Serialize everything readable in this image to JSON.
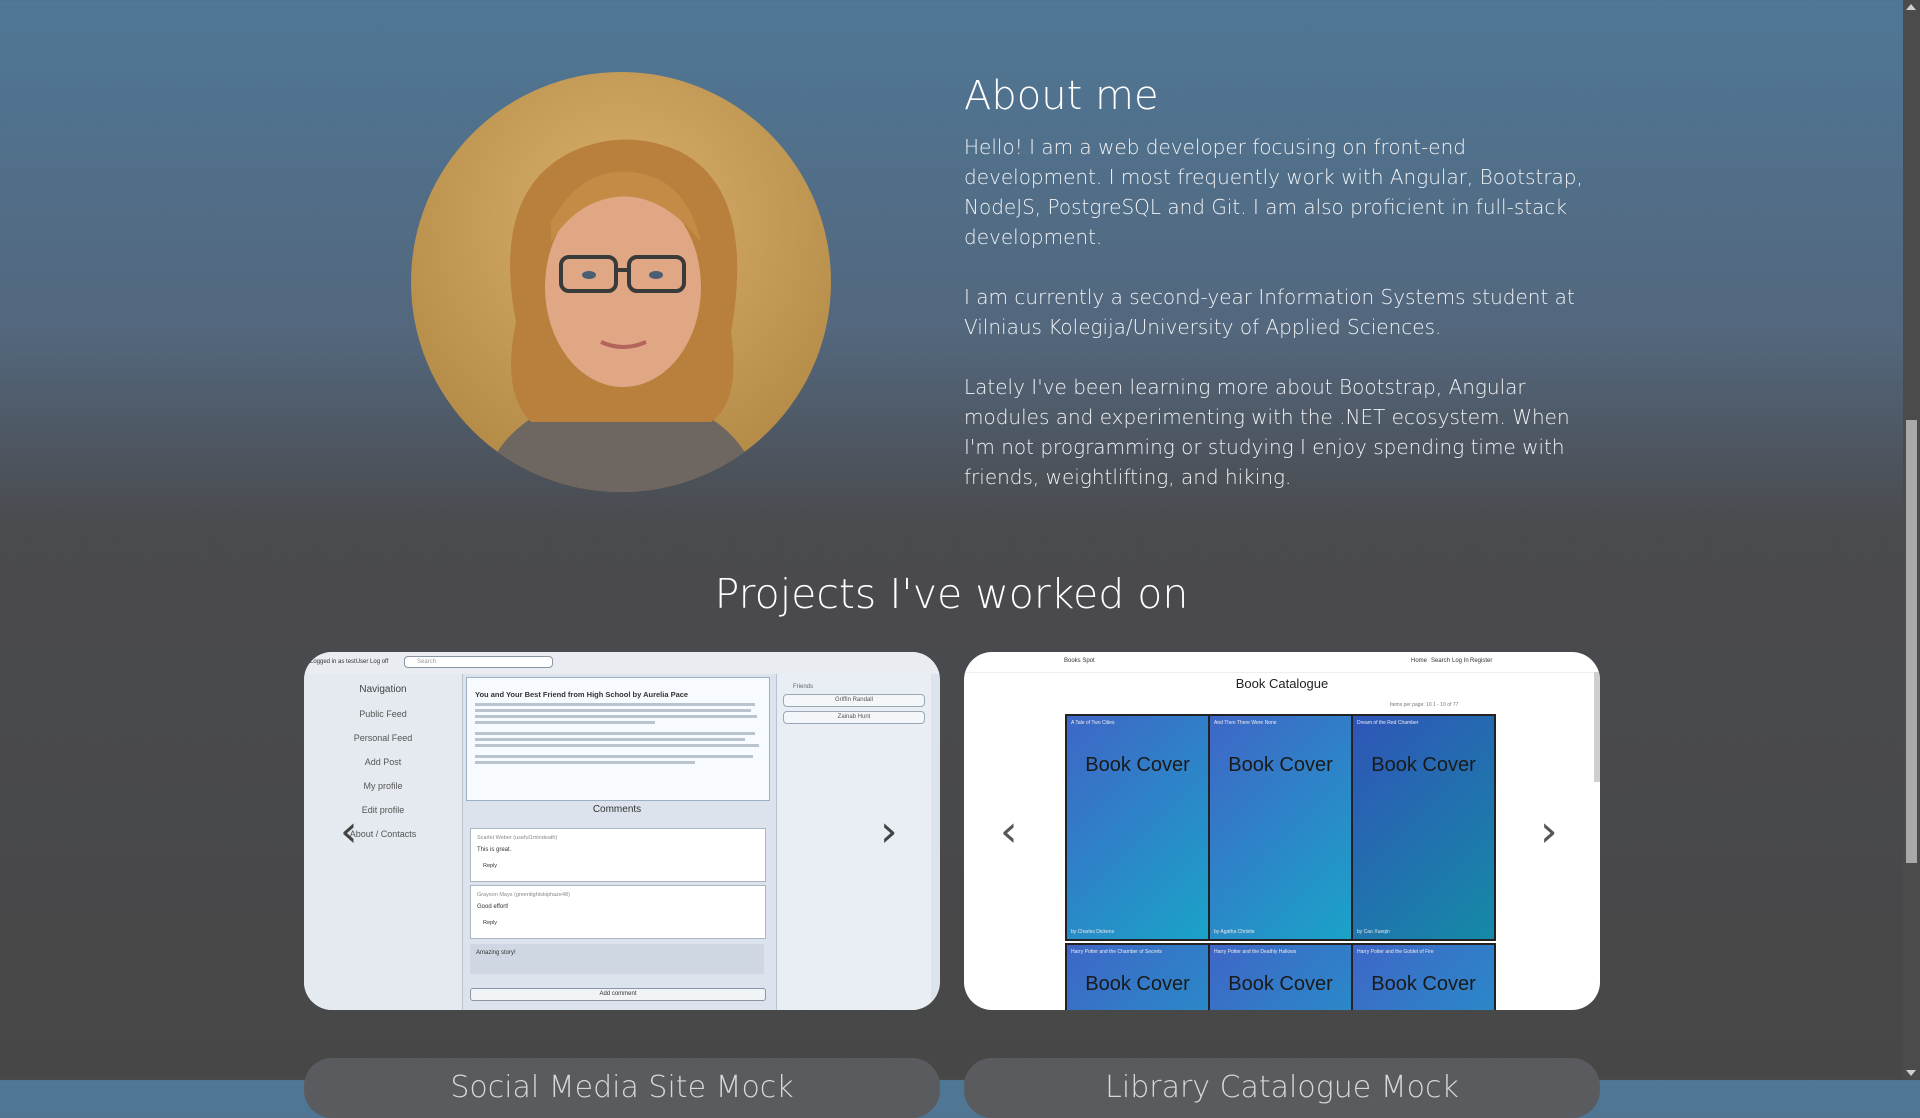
{
  "about": {
    "title": "About me",
    "p1": "Hello! I am a web developer focusing on front-end development. I most frequently work with Angular, Bootstrap, NodeJS, PostgreSQL and Git. I am also proficient in full-stack development.",
    "p2": "I am currently a second-year Information Systems student at Vilniaus Kolegija/University of Applied Sciences.",
    "p3": "Lately I've been learning more about Bootstrap, Angular modules and experimenting with the .NET ecosystem. When I'm not programming or studying I enjoy spending time with friends, weightlifting, and hiking."
  },
  "projects": {
    "title": "Projects I've worked on",
    "prev_glyph": "‹",
    "next_glyph": "›",
    "card1": {
      "topbar": "Logged in as testUser   Log off",
      "search_placeholder": "Search",
      "nav_title": "Navigation",
      "nav_items": [
        "Public Feed",
        "Personal Feed",
        "Add Post",
        "My profile",
        "Edit profile",
        "About / Contacts"
      ],
      "post_title": "You and Your Best Friend from High School by Aurelia Pace",
      "comments_title": "Comments",
      "comment1_author": "Scarlet Weber (useful1mindeath)",
      "comment1_text": "This is great.",
      "comment2_author": "Grayson Mays (greentightskiphaze48)",
      "comment2_text": "Good effort!",
      "reply_label": "Reply",
      "new_comment": "Amazing story!",
      "add_comment": "Add comment",
      "friends_label": "Friends",
      "friend1": "Griffin Randall",
      "friend2": "Zainab Hunt"
    },
    "card2": {
      "brand": "Books Spot",
      "nav": [
        "Home",
        "Search",
        "Log In",
        "Register"
      ],
      "title": "Book Catalogue",
      "pager": "Items per page: 10   1 - 10 of 77",
      "cover_text": "Book Cover",
      "books": [
        {
          "title": "A Tale of Two Cities",
          "author": "by Charles Dickens"
        },
        {
          "title": "And Then There Were None",
          "author": "by Agatha Christie"
        },
        {
          "title": "Dream of the Red Chamber",
          "author": "by Cao Xueqin"
        },
        {
          "title": "Harry Potter and the Chamber of Secrets",
          "author": ""
        },
        {
          "title": "Harry Potter and the Deathly Hallows",
          "author": ""
        },
        {
          "title": "Harry Potter and the Goblet of Fire",
          "author": ""
        }
      ]
    },
    "card3_title": "Social Media Site Mock",
    "card4_title": "Library Catalogue Mock"
  },
  "colors": {
    "page_top": "#4f7796",
    "page_bottom": "#474747"
  }
}
